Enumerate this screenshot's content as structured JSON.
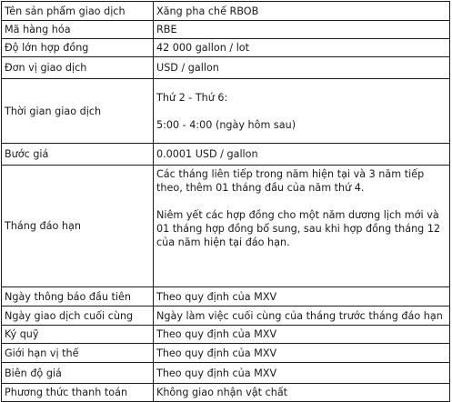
{
  "spec_table": {
    "rows": [
      {
        "label": "Tên sản phẩm giao dịch",
        "value": [
          "Xăng pha chế RBOB"
        ]
      },
      {
        "label": "Mã hàng hóa",
        "value": [
          "RBE"
        ]
      },
      {
        "label": "Độ lớn hợp đồng",
        "value": [
          "42 000 gallon / lot"
        ]
      },
      {
        "label": "Đơn vị giao dịch",
        "value": [
          "USD / gallon"
        ]
      },
      {
        "label": "Thời gian giao dịch",
        "value": [
          "Thứ 2 - Thứ 6:",
          "",
          "5:00 - 4:00 (ngày hôm sau)"
        ]
      },
      {
        "label": "Bước giá",
        "value": [
          "0.0001 USD / gallon"
        ]
      },
      {
        "label": "Tháng đáo hạn",
        "value": [
          "Các tháng liên tiếp trong năm hiện tại và 3 năm tiếp",
          "theo, thêm 01 tháng đầu của năm thứ 4.",
          "",
          "Niêm yết các hợp đồng cho một năm dương lịch mới và",
          "01 tháng hợp đồng bổ sung, sau khi hợp đồng tháng 12",
          "của năm hiện tại đáo hạn."
        ]
      },
      {
        "label": "Ngày thông báo đầu tiên",
        "value": [
          "Theo quy định của MXV"
        ]
      },
      {
        "label": "Ngày giao dịch cuối cùng",
        "value": [
          "Ngày làm việc cuối cùng của tháng trước tháng đáo hạn"
        ]
      },
      {
        "label": "Ký quỹ",
        "value": [
          "Theo quy định của MXV"
        ]
      },
      {
        "label": "Giới hạn vị thế",
        "value": [
          "Theo quy định của MXV"
        ]
      },
      {
        "label": "Biên độ giá",
        "value": [
          "Theo quy định của MXV"
        ]
      },
      {
        "label": "Phương thức thanh toán",
        "value": [
          "Không giao nhận vật chất"
        ]
      }
    ]
  }
}
